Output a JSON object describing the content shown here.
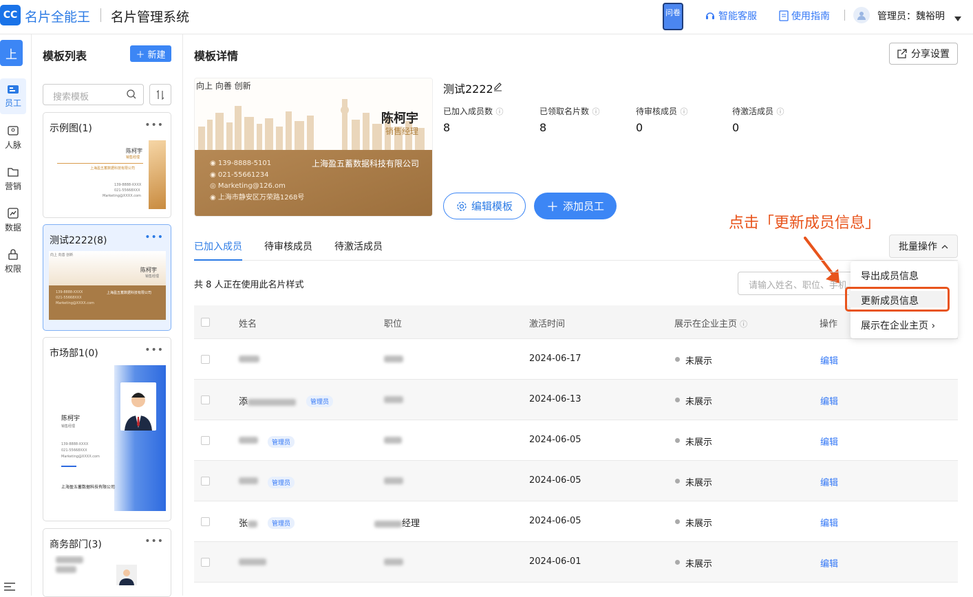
{
  "header": {
    "logo": "CC",
    "brand": "名片全能王",
    "system_title": "名片管理系统",
    "survey": "问卷",
    "service": "智能客服",
    "guide": "使用指南",
    "admin_label": "管理员：魏裕明"
  },
  "nav": {
    "org": "上",
    "items": [
      {
        "label": "员工"
      },
      {
        "label": "人脉"
      },
      {
        "label": "营销"
      },
      {
        "label": "数据"
      },
      {
        "label": "权限"
      }
    ]
  },
  "template_list": {
    "title": "模板列表",
    "new_button": "新建",
    "search_placeholder": "搜索模板",
    "templates": [
      {
        "name": "示例图(1)"
      },
      {
        "name": "测试2222(8)"
      },
      {
        "name": "市场部1(0)"
      },
      {
        "name": "商务部门(3)"
      }
    ]
  },
  "mini_cards": {
    "name": "陈柯宇",
    "role": "销售经理",
    "company": "上海盈五蓄数据科技有限公司",
    "phone": "139-8888-XXXX",
    "tel": "021-55668XXX",
    "email": "Marketing@XXXX.com",
    "slogan": "向上 向善 创新"
  },
  "detail": {
    "title": "模板详情",
    "share_button": "分享设置",
    "card": {
      "slogan": "向上 向善 创新",
      "name": "陈柯宇",
      "role": "销售经理",
      "phone": "139-8888-5101",
      "tel": "021-55661234",
      "email": "Marketing@126.om",
      "address": "上海市静安区万荣路1268号",
      "company": "上海盈五蓄数据科技有限公司"
    },
    "template_name": "测试2222",
    "stats": [
      {
        "label": "已加入成员数",
        "value": "8"
      },
      {
        "label": "已领取名片数",
        "value": "8"
      },
      {
        "label": "待审核成员",
        "value": "0"
      },
      {
        "label": "待激活成员",
        "value": "0"
      }
    ],
    "edit_template": "编辑模板",
    "add_employee": "添加员工"
  },
  "annotation": "点击「更新成员信息」",
  "tabs": [
    "已加入成员",
    "待审核成员",
    "待激活成员"
  ],
  "batch_button": "批量操作",
  "summary": "共 8 人正在使用此名片样式",
  "member_search_placeholder": "请输入姓名、职位、手机",
  "dropdown": [
    "导出成员信息",
    "更新成员信息",
    "展示在企业主页"
  ],
  "table": {
    "headers": [
      "姓名",
      "职位",
      "激活时间",
      "展示在企业主页",
      "操作"
    ],
    "admin_tag": "管理员",
    "rows": [
      {
        "name": "",
        "title": "",
        "date": "2024-06-17",
        "status": "未展示",
        "action": "编辑",
        "admin": false
      },
      {
        "name": "添",
        "title": "",
        "date": "2024-06-13",
        "status": "未展示",
        "action": "编辑",
        "admin": true
      },
      {
        "name": "",
        "title": "",
        "date": "2024-06-05",
        "status": "未展示",
        "action": "编辑",
        "admin": true
      },
      {
        "name": "",
        "title": "",
        "date": "2024-06-05",
        "status": "未展示",
        "action": "编辑",
        "admin": true
      },
      {
        "name": "张",
        "title": "经理",
        "date": "2024-06-05",
        "status": "未展示",
        "action": "编辑",
        "admin": true
      },
      {
        "name": "",
        "title": "",
        "date": "2024-06-01",
        "status": "未展示",
        "action": "编辑",
        "admin": false
      }
    ]
  },
  "colors": {
    "accent": "#3c86f5",
    "annotation": "#e8541c"
  }
}
